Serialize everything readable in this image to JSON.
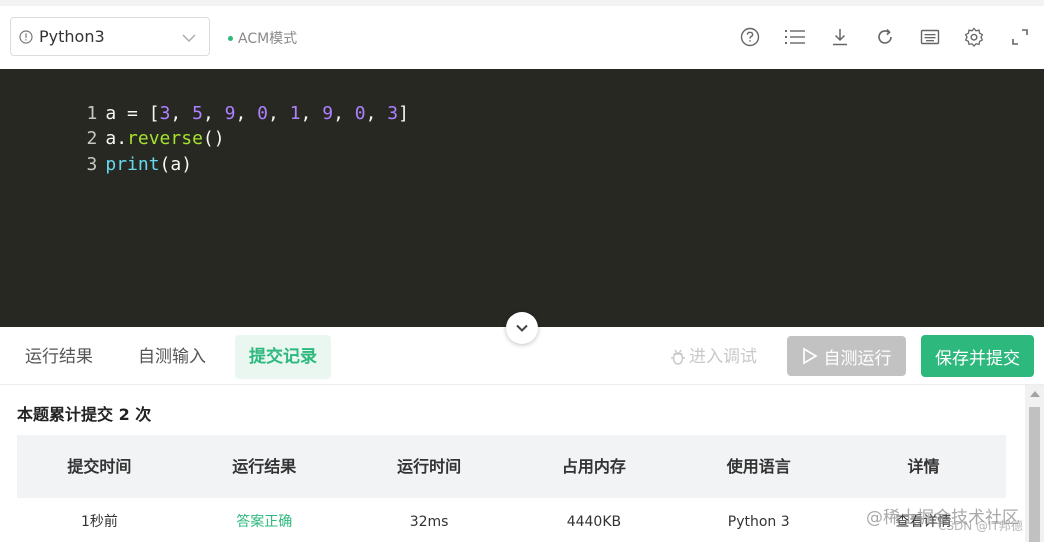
{
  "header": {
    "language": "Python3",
    "mode": "ACM模式",
    "accent": "#2db87d"
  },
  "editor": {
    "line_numbers": [
      "1",
      "2",
      "3"
    ],
    "line1": {
      "var": "a",
      "eq": " = ",
      "open": "[",
      "nums": [
        "3",
        "5",
        "9",
        "0",
        "1",
        "9",
        "0",
        "3"
      ],
      "sep": ", ",
      "close": "]"
    },
    "line2": {
      "obj": "a",
      "dot": ".",
      "method": "reverse",
      "parens": "()"
    },
    "line3": {
      "fn": "print",
      "open": "(",
      "arg": "a",
      "close": ")"
    }
  },
  "tabs": {
    "items": [
      "运行结果",
      "自测输入",
      "提交记录"
    ],
    "active": "提交记录"
  },
  "actions": {
    "debug": "进入调试",
    "run": "自测运行",
    "submit": "保存并提交"
  },
  "results": {
    "summary": "本题累计提交 2 次",
    "headers": [
      "提交时间",
      "运行结果",
      "运行时间",
      "占用内存",
      "使用语言",
      "详情"
    ],
    "rows": [
      [
        "1秒前",
        "答案正确",
        "32ms",
        "4440KB",
        "Python 3",
        "查看详情"
      ]
    ]
  },
  "watermark": {
    "main": "@稀土掘金技术社区",
    "sub": "CSDN @IT邦德"
  },
  "icons": [
    "info-icon",
    "chevron-down-icon",
    "help-icon",
    "list-icon",
    "download-icon",
    "refresh-icon",
    "keyboard-icon",
    "gear-icon",
    "fullscreen-icon",
    "collapse-chevron-icon",
    "bug-icon",
    "play-icon"
  ]
}
